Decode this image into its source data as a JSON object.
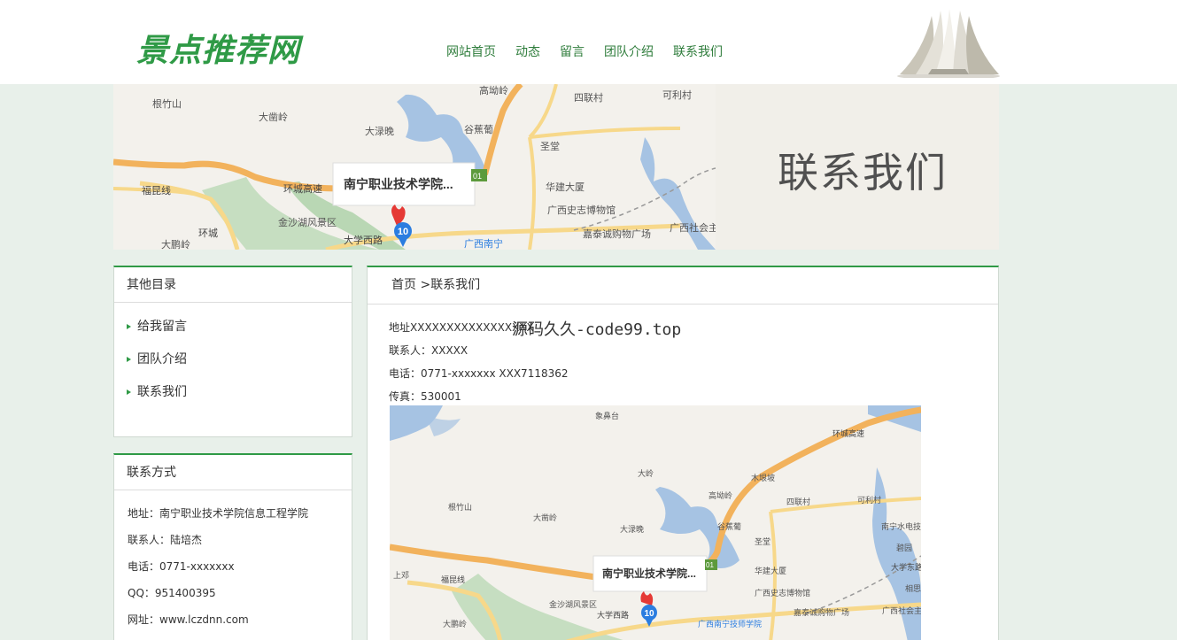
{
  "site": {
    "logo": "景点推荐网"
  },
  "nav": [
    {
      "label": "网站首页"
    },
    {
      "label": "动态"
    },
    {
      "label": "留言"
    },
    {
      "label": "团队介绍"
    },
    {
      "label": "联系我们"
    }
  ],
  "banner": {
    "title": "联系我们",
    "map": {
      "marker_label": "南宁职业技术学院...",
      "marker_number": "10",
      "labels": [
        "根竹山",
        "大凿岭",
        "高坳岭",
        "四联村",
        "可利村",
        "大渌晚",
        "谷蕉葡",
        "圣堂",
        "华建大厦",
        "广西史志博物馆",
        "嘉泰诚购物广场",
        "广西社会主义学院",
        "金沙湖风景区",
        "福昆线",
        "环城高速",
        "大学西路",
        "广西南宁",
        "大鹏岭",
        "环城",
        "01"
      ]
    }
  },
  "sidebar": {
    "catalog": {
      "title": "其他目录",
      "items": [
        {
          "label": "给我留言"
        },
        {
          "label": "团队介绍"
        },
        {
          "label": "联系我们"
        }
      ]
    },
    "contact": {
      "title": "联系方式",
      "lines": [
        "地址：南宁职业技术学院信息工程学院",
        "联系人：陆培杰",
        "电话：0771-xxxxxxx",
        "QQ：951400395",
        "网址：www.lczdnn.com"
      ]
    }
  },
  "main": {
    "breadcrumb": {
      "home": "首页",
      "separator": " >",
      "current": "联系我们"
    },
    "watermark": "源码久久-code99.top",
    "info": [
      "地址XXXXXXXXXXXXXXXXX",
      "联系人：XXXXX",
      "电话：0771-xxxxxxx  XXX7118362",
      "传真：530001"
    ],
    "map": {
      "marker_label": "南宁职业技术学院...",
      "marker_number": "10",
      "labels": [
        "象鼻台",
        "环城高速",
        "大岭",
        "高坳岭",
        "木垠坡",
        "四联村",
        "可利村",
        "根竹山",
        "大凿岭",
        "大渌晚",
        "谷蕉葡",
        "圣堂",
        "南宁水电技工学校",
        "碧园",
        "大学东路",
        "华建大厦",
        "广西史志博物馆",
        "嘉泰诚购物广场",
        "广西社会主义学院",
        "金沙湖风景区",
        "福昆线",
        "大学西路",
        "广西南宁技师学院",
        "大鹏岭",
        "上邓",
        "相思",
        "01"
      ]
    }
  },
  "colors": {
    "brand": "#2f9a46",
    "page_bg": "#e8f0ea",
    "map_land": "#f3f1ec",
    "map_water": "#a6c3e3",
    "map_park": "#c6dec1",
    "map_road": "#f2b25c"
  }
}
